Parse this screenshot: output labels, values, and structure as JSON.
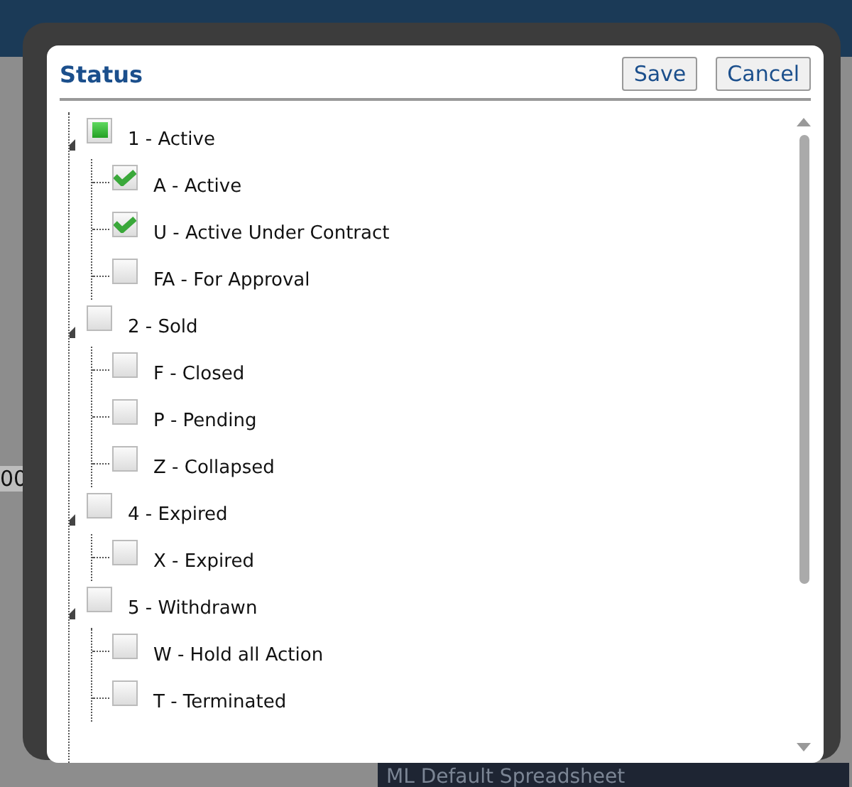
{
  "background": {
    "cell_text": "00",
    "footer_text": "ML Default Spreadsheet"
  },
  "dialog": {
    "title": "Status",
    "buttons": [
      {
        "label": "Save"
      },
      {
        "label": "Cancel"
      }
    ]
  },
  "tree": [
    {
      "label": "1 - Active",
      "checked": false,
      "indeterminate": true,
      "expanded": true,
      "children": [
        {
          "label": "A - Active",
          "checked": true
        },
        {
          "label": "U - Active Under Contract",
          "checked": true
        },
        {
          "label": "FA - For Approval",
          "checked": false
        }
      ]
    },
    {
      "label": "2 - Sold",
      "checked": false,
      "indeterminate": false,
      "expanded": true,
      "children": [
        {
          "label": "F - Closed",
          "checked": false
        },
        {
          "label": "P - Pending",
          "checked": false
        },
        {
          "label": "Z - Collapsed",
          "checked": false
        }
      ]
    },
    {
      "label": "4 - Expired",
      "checked": false,
      "indeterminate": false,
      "expanded": true,
      "children": [
        {
          "label": "X - Expired",
          "checked": false
        }
      ]
    },
    {
      "label": "5 - Withdrawn",
      "checked": false,
      "indeterminate": false,
      "expanded": true,
      "children": [
        {
          "label": "W - Hold all Action",
          "checked": false
        },
        {
          "label": "T - Terminated",
          "checked": false
        }
      ]
    }
  ]
}
